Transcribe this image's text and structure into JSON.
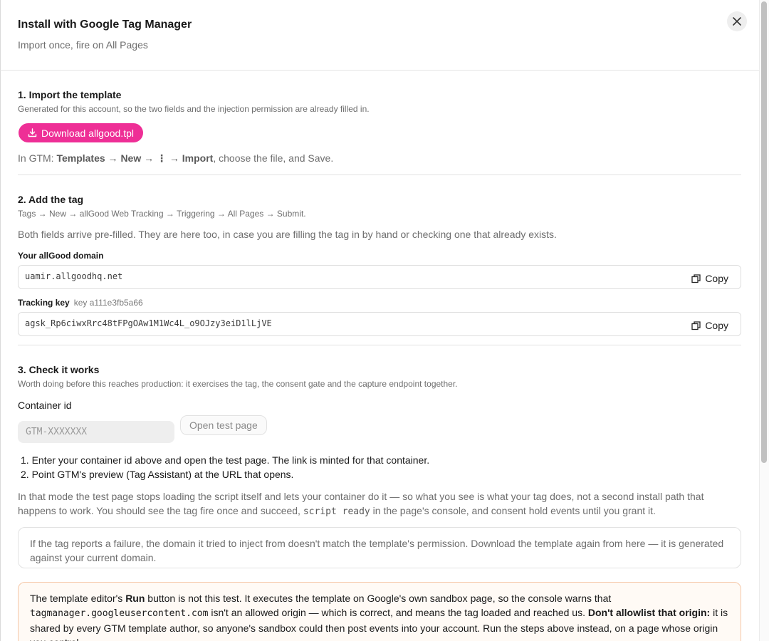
{
  "header": {
    "title": "Install with Google Tag Manager",
    "subtitle": "Import once, fire on All Pages"
  },
  "step1": {
    "title": "1. Import the template",
    "sub": "Generated for this account, so the two fields and the injection permission are already filled in.",
    "download_label": "Download allgood.tpl",
    "gtm_prefix": "In GTM: ",
    "gtm_path": "Templates → New → ⋮ → Import",
    "gtm_suffix": ", choose the file, and Save."
  },
  "step2": {
    "title": "2. Add the tag",
    "sub": "Tags → New → allGood Web Tracking → Triggering → All Pages → Submit.",
    "body": "Both fields arrive pre-filled. They are here too, in case you are filling the tag in by hand or checking one that already exists.",
    "domain_label": "Your allGood domain",
    "domain_value": "uamir.allgoodhq.net",
    "key_label": "Tracking key",
    "key_hint": "key a111e3fb5a66",
    "key_value": "agsk_Rp6ciwxRrc48tFPgOAw1M1Wc4L_o9OJzy3eiD1lLjVE",
    "copy_label": "Copy"
  },
  "step3": {
    "title": "3. Check it works",
    "sub": "Worth doing before this reaches production: it exercises the tag, the consent gate and the capture endpoint together.",
    "container_label": "Container id",
    "container_placeholder": "GTM-XXXXXXX",
    "open_test_label": "Open test page",
    "steps": [
      "Enter your container id above and open the test page. The link is minted for that container.",
      "Point GTM's preview (Tag Assistant) at the URL that opens."
    ],
    "para_a": "In that mode the test page stops loading the script itself and lets your container do it — so what you see is what your tag does, not a second install path that happens to work. You should see the tag fire once and succeed, ",
    "para_code": "script ready",
    "para_b": " in the page's console, and consent hold events until you grant it.",
    "failure_note": "If the tag reports a failure, the domain it tried to inject from doesn't match the template's permission. Download the template again from here — it is generated against your current domain.",
    "warn_a": "The template editor's ",
    "warn_run": "Run",
    "warn_b": " button is not this test. It executes the template on Google's own sandbox page, so the console warns that ",
    "warn_code": "tagmanager.googleusercontent.com",
    "warn_c": " isn't an allowed origin — which is correct, and means the tag loaded and reached us. ",
    "warn_bold": "Don't allowlist that origin:",
    "warn_d": " it is shared by every GTM template author, so anyone's sandbox could then post events into your account. Run the steps above instead, on a page whose origin you control."
  }
}
